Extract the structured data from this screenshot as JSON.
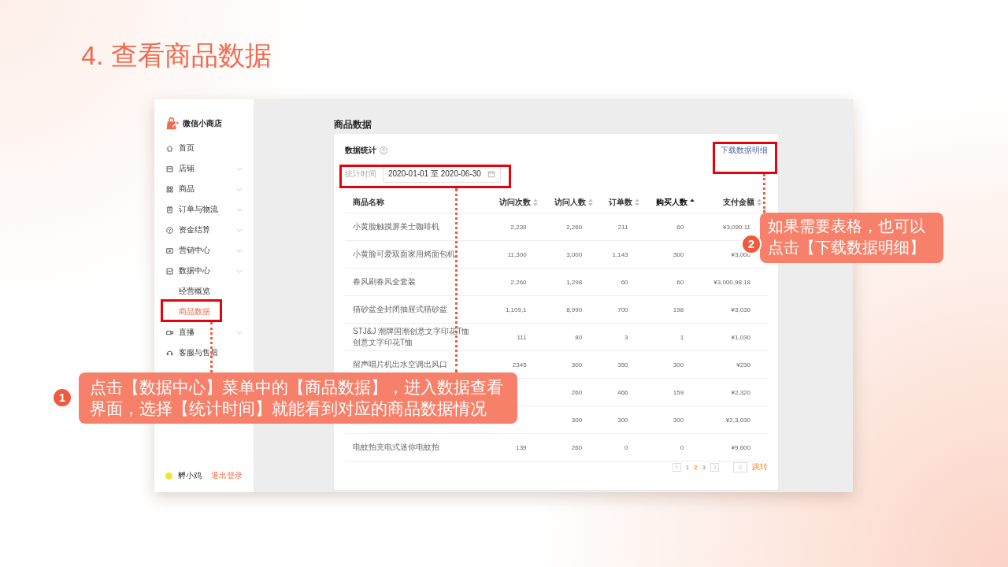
{
  "slide_title": "4. 查看商品数据",
  "app": {
    "shop_name": "微信小商店",
    "sidebar": {
      "items": [
        {
          "label": "首页",
          "expandable": false
        },
        {
          "label": "店铺",
          "expandable": true
        },
        {
          "label": "商品",
          "expandable": true
        },
        {
          "label": "订单与物流",
          "expandable": true
        },
        {
          "label": "资金结算",
          "expandable": true
        },
        {
          "label": "营销中心",
          "expandable": true
        },
        {
          "label": "数据中心",
          "expandable": true,
          "children": [
            {
              "label": "经营概览",
              "selected": false
            },
            {
              "label": "商品数据",
              "selected": true
            }
          ]
        },
        {
          "label": "直播",
          "expandable": true
        },
        {
          "label": "客服与售后",
          "expandable": false
        }
      ],
      "user": {
        "name": "孵小鸡",
        "logout": "退出登录"
      }
    },
    "page_title": "商品数据",
    "card": {
      "title": "数据统计",
      "download_link": "下载数据明细",
      "filter_label": "统计时间",
      "date_range": "2020-01-01 至 2020-06-30"
    },
    "table": {
      "columns": [
        {
          "label": "商品名称",
          "sortable": false,
          "sorted": false
        },
        {
          "label": "访问次数",
          "sortable": true,
          "sorted": false
        },
        {
          "label": "访问人数",
          "sortable": true,
          "sorted": false
        },
        {
          "label": "订单数",
          "sortable": true,
          "sorted": false
        },
        {
          "label": "购买人数",
          "sortable": true,
          "sorted": true
        },
        {
          "label": "支付金额",
          "sortable": true,
          "sorted": false
        }
      ],
      "rows": [
        {
          "name": "小黄脸触摸屏美士咖啡机",
          "visits": "2,239",
          "visitors": "2,260",
          "orders": "211",
          "buyers": "60",
          "amount": "¥3,090.11"
        },
        {
          "name": "小黄脸可爱双面家用烤面包机",
          "visits": "11,300",
          "visitors": "3,000",
          "orders": "1,143",
          "buyers": "300",
          "amount": "¥3,000"
        },
        {
          "name": "春风刷春风全套装",
          "visits": "2,260",
          "visitors": "1,298",
          "orders": "60",
          "buyers": "60",
          "amount": "¥3,000,98.18"
        },
        {
          "name": "猫砂盆全封闭抽屉式猫砂盆",
          "visits": "1,109,1",
          "visitors": "8,990",
          "orders": "700",
          "buyers": "198",
          "amount": "¥3,030"
        },
        {
          "name": "STJ&J 潮牌国潮创意文字印花T恤创意文字印花T恤",
          "visits": "111",
          "visitors": "80",
          "orders": "3",
          "buyers": "1",
          "amount": "¥1,030"
        },
        {
          "name": "留声唱片机出水空调出风口",
          "visits": "2345",
          "visitors": "300",
          "orders": "350",
          "buyers": "300",
          "amount": "¥230"
        },
        {
          "visitors": "260",
          "orders": "466",
          "buyers": "159",
          "amount": "¥2,320"
        },
        {
          "visitors": "300",
          "orders": "300",
          "buyers": "300",
          "amount": "¥2,3,030"
        },
        {
          "name": "电蚊拍充电式迷你电蚊拍",
          "visits": "139",
          "visitors": "260",
          "orders": "0",
          "buyers": "0",
          "amount": "¥9,600"
        }
      ]
    },
    "pagination": {
      "pages": [
        {
          "label": "1",
          "selected": false
        },
        {
          "label": "2",
          "selected": true
        },
        {
          "label": "3",
          "selected": false
        }
      ],
      "jump_value": "0",
      "jump_button": "跳转"
    }
  },
  "annotations": [
    {
      "number": "1",
      "text": "点击【数据中心】菜单中的【商品数据】，进入数据查看界面，选择【统计时间】就能看到对应的商品数据情况"
    },
    {
      "number": "2",
      "text": "如果需要表格，也可以点击【下载数据明细】"
    }
  ]
}
